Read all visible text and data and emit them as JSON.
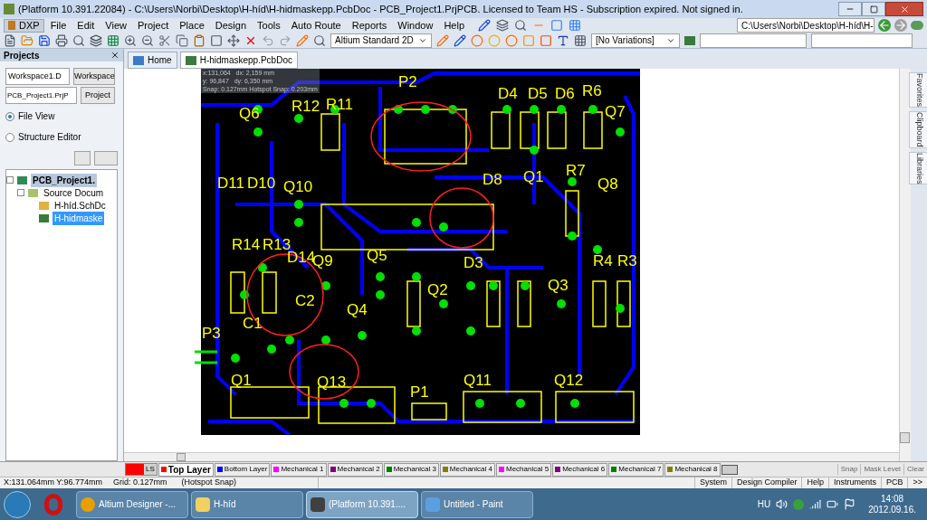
{
  "window": {
    "title": "(Platform 10.391.22084) - C:\\Users\\Norbi\\Desktop\\H-híd\\H-hidmaskepp.PcbDoc - PCB_Project1.PrjPCB. Licensed to Team HS - Subscription expired. Not signed in."
  },
  "menu": {
    "logo": "DXP",
    "items": [
      "File",
      "Edit",
      "View",
      "Project",
      "Place",
      "Design",
      "Tools",
      "Auto Route",
      "Reports",
      "Window",
      "Help"
    ]
  },
  "toolbar": {
    "path": "C:\\Users\\Norbi\\Desktop\\H-híd\\H-",
    "view_mode": "Altium Standard 2D",
    "variations": "[No Variations]"
  },
  "projects_panel": {
    "title": "Projects",
    "workspace": "Workspace1.D",
    "workspace_button": "Workspace",
    "project": "PCB_Project1.PrjP",
    "project_button": "Project",
    "views": [
      {
        "label": "File View",
        "selected": true
      },
      {
        "label": "Structure Editor",
        "selected": false
      }
    ],
    "tree": [
      {
        "label": "PCB_Project1.",
        "kind": "project",
        "selected": false,
        "children": [
          {
            "label": "Source Docum",
            "kind": "folder",
            "selected": false,
            "children": [
              {
                "label": "H-híd.SchDc",
                "kind": "schematic",
                "selected": false
              },
              {
                "label": "H-hidmaske",
                "kind": "pcb",
                "selected": true
              }
            ]
          }
        ]
      }
    ]
  },
  "document_tabs": [
    {
      "label": "Home",
      "selected": false
    },
    {
      "label": "H-hidmaskepp.PcbDoc",
      "selected": true
    }
  ],
  "canvas": {
    "hud": [
      "x:131,064   dx: 2,159 mm",
      "y: 96,847   dy: 6,350 mm",
      "Snap: 0.127mm Hotspot Snap: 0.203mm"
    ],
    "labels": [
      "P2",
      "R12",
      "R11",
      "D4",
      "D5",
      "D6",
      "R6",
      "Q6",
      "Q7",
      "D11",
      "D10",
      "Q10",
      "D8",
      "Q1",
      "R7",
      "Q8",
      "R14",
      "R13",
      "D14",
      "Q9",
      "Q5",
      "D3",
      "R4",
      "R3",
      "C2",
      "Q2",
      "Q3",
      "P3",
      "C1",
      "Q4",
      "Q1",
      "Q13",
      "P1",
      "Q11",
      "Q12"
    ]
  },
  "side_tabs": [
    "Favorites",
    "Clipboard",
    "Libraries"
  ],
  "layer_tabs": {
    "current": "LS",
    "layers": [
      {
        "label": "Top Layer",
        "color": "#ff0000",
        "selected": true
      },
      {
        "label": "Bottom Layer",
        "color": "#0000ff",
        "selected": false
      },
      {
        "label": "Mechanical 1",
        "color": "#ff00ff",
        "selected": false
      },
      {
        "label": "Mechanical 2",
        "color": "#800080",
        "selected": false
      },
      {
        "label": "Mechanical 3",
        "color": "#008000",
        "selected": false
      },
      {
        "label": "Mechanical 4",
        "color": "#808000",
        "selected": false
      },
      {
        "label": "Mechanical 5",
        "color": "#ff00ff",
        "selected": false
      },
      {
        "label": "Mechanical 6",
        "color": "#800080",
        "selected": false
      },
      {
        "label": "Mechanical 7",
        "color": "#008000",
        "selected": false
      },
      {
        "label": "Mechanical 8",
        "color": "#808000",
        "selected": false
      }
    ],
    "buttons": [
      "Snap",
      "Mask Level",
      "Clear"
    ]
  },
  "status_bar": {
    "coords": "X:131.064mm Y:96.774mm",
    "grid": "Grid: 0.127mm",
    "snap": "(Hotspot Snap)",
    "panels": [
      "System",
      "Design Compiler",
      "Help",
      "Instruments",
      "PCB",
      ">>"
    ]
  },
  "taskbar": {
    "apps": [
      {
        "label": "Altium Designer -...",
        "kind": "browser",
        "selected": false
      },
      {
        "label": "H-híd",
        "kind": "folder",
        "selected": false
      },
      {
        "label": "(Platform 10.391....",
        "kind": "altium",
        "selected": true
      },
      {
        "label": "Untitled - Paint",
        "kind": "paint",
        "selected": false
      }
    ],
    "language": "HU",
    "time": "14:08",
    "date": "2012.09.16."
  }
}
